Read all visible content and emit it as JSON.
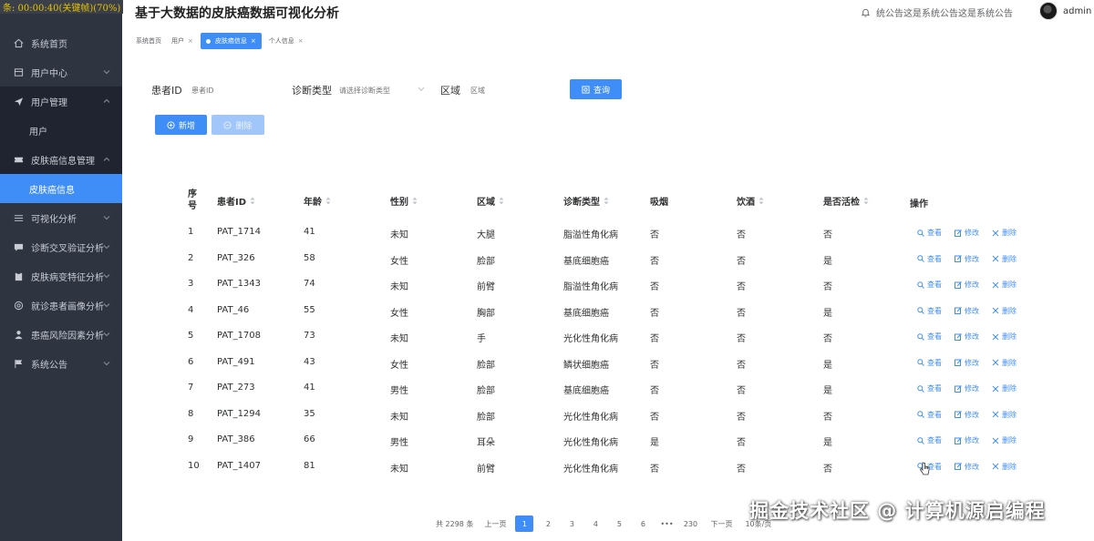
{
  "overlay_time": "条: 00:00:40(关键帧)(70%)",
  "header": {
    "title": "基于大数据的皮肤癌数据可视化分析",
    "notice": "统公告这是系统公告这是系统公告",
    "user": "admin"
  },
  "sidebar": {
    "items": [
      {
        "label": "系统首页",
        "icon": "home-icon"
      },
      {
        "label": "用户中心",
        "icon": "user-center-icon"
      },
      {
        "label": "用户管理",
        "icon": "send-icon"
      },
      {
        "label": "用户"
      },
      {
        "label": "皮肤癌信息管理",
        "icon": "ticket-icon"
      },
      {
        "label": "皮肤癌信息"
      },
      {
        "label": "可视化分析",
        "icon": "list-icon"
      },
      {
        "label": "诊断交叉验证分析",
        "icon": "message-icon"
      },
      {
        "label": "皮肤病变特征分析",
        "icon": "clipboard-icon"
      },
      {
        "label": "就诊患者画像分析",
        "icon": "aperture-icon"
      },
      {
        "label": "患癌风险因素分析",
        "icon": "person-icon"
      },
      {
        "label": "系统公告",
        "icon": "flag-icon"
      }
    ]
  },
  "tabs": [
    {
      "label": "系统首页"
    },
    {
      "label": "用户"
    },
    {
      "label": "皮肤癌信息"
    },
    {
      "label": "个人信息"
    }
  ],
  "search": {
    "patient_label": "患者ID",
    "patient_placeholder": "患者ID",
    "diag_label": "诊断类型",
    "diag_placeholder": "请选择诊断类型",
    "region_label": "区域",
    "region_placeholder": "区域",
    "query_button": "查询"
  },
  "actions": {
    "add": "新增",
    "delete": "删除"
  },
  "table": {
    "headers": {
      "no_line1": "序",
      "no_line2": "号",
      "patient": "患者ID",
      "age": "年龄",
      "gender": "性别",
      "region": "区域",
      "diag": "诊断类型",
      "smoke": "吸烟",
      "drink": "饮酒",
      "biopsy": "是否活检",
      "ops": "操作"
    },
    "op_labels": {
      "view": "查看",
      "edit": "修改",
      "delete": "删除"
    },
    "rows": [
      {
        "no": "1",
        "id": "PAT_1714",
        "age": "41",
        "gender": "未知",
        "region": "大腿",
        "diag": "脂溢性角化病",
        "smoke": "否",
        "drink": "否",
        "biopsy": "否"
      },
      {
        "no": "2",
        "id": "PAT_326",
        "age": "58",
        "gender": "女性",
        "region": "脸部",
        "diag": "基底细胞癌",
        "smoke": "否",
        "drink": "否",
        "biopsy": "是"
      },
      {
        "no": "3",
        "id": "PAT_1343",
        "age": "74",
        "gender": "未知",
        "region": "前臂",
        "diag": "脂溢性角化病",
        "smoke": "否",
        "drink": "否",
        "biopsy": "否"
      },
      {
        "no": "4",
        "id": "PAT_46",
        "age": "55",
        "gender": "女性",
        "region": "胸部",
        "diag": "基底细胞癌",
        "smoke": "否",
        "drink": "否",
        "biopsy": "是"
      },
      {
        "no": "5",
        "id": "PAT_1708",
        "age": "73",
        "gender": "未知",
        "region": "手",
        "diag": "光化性角化病",
        "smoke": "否",
        "drink": "否",
        "biopsy": "否"
      },
      {
        "no": "6",
        "id": "PAT_491",
        "age": "43",
        "gender": "女性",
        "region": "脸部",
        "diag": "鳞状细胞癌",
        "smoke": "否",
        "drink": "否",
        "biopsy": "是"
      },
      {
        "no": "7",
        "id": "PAT_273",
        "age": "41",
        "gender": "男性",
        "region": "脸部",
        "diag": "基底细胞癌",
        "smoke": "否",
        "drink": "否",
        "biopsy": "是"
      },
      {
        "no": "8",
        "id": "PAT_1294",
        "age": "35",
        "gender": "未知",
        "region": "脸部",
        "diag": "光化性角化病",
        "smoke": "否",
        "drink": "否",
        "biopsy": "否"
      },
      {
        "no": "9",
        "id": "PAT_386",
        "age": "66",
        "gender": "男性",
        "region": "耳朵",
        "diag": "光化性角化病",
        "smoke": "是",
        "drink": "否",
        "biopsy": "是"
      },
      {
        "no": "10",
        "id": "PAT_1407",
        "age": "81",
        "gender": "未知",
        "region": "前臂",
        "diag": "光化性角化病",
        "smoke": "否",
        "drink": "否",
        "biopsy": "否"
      }
    ]
  },
  "pagination": {
    "total": "共 2298 条",
    "prev": "上一页",
    "pages": [
      "1",
      "2",
      "3",
      "4",
      "5",
      "6",
      "•••",
      "230"
    ],
    "current": "1",
    "next": "下一页",
    "jump": "10条/页"
  },
  "watermark": "掘金技术社区 @ 计算机源启编程",
  "colors": {
    "accent": "#3f8ef7",
    "sidebar": "#2f3441",
    "sidebar_dark": "#1f2430"
  }
}
